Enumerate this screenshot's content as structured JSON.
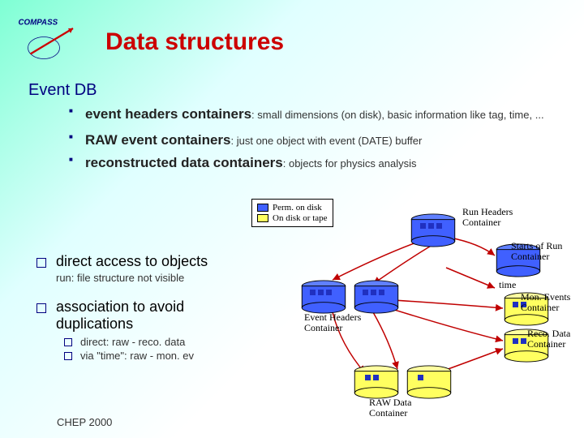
{
  "logo_text": "COMPASS",
  "title": "Data structures",
  "section_heading": "Event DB",
  "bullets": [
    {
      "strong": "event headers containers",
      "rest": ": small dimensions (on disk), basic information like tag, time, ..."
    },
    {
      "strong": "RAW event containers",
      "rest": ": just one object with event (DATE) buffer"
    },
    {
      "strong": "reconstructed data containers",
      "rest": ": objects for physics analysis"
    }
  ],
  "q_items": [
    {
      "title": "direct access to objects",
      "sub": "run: file structure not visible"
    },
    {
      "title": "association to avoid duplications",
      "bullets": [
        "direct: raw - reco. data",
        "via \"time\": raw - mon. ev"
      ]
    }
  ],
  "legend": {
    "perm": "Perm. on disk",
    "tape": "On disk or tape"
  },
  "diagram_labels": {
    "run_headers": "Run Headers\nContainer",
    "starts_run": "Starts of Run\nContainer",
    "event_headers": "Event Headers\nContainer",
    "mon_events": "Mon. Events\nContainer",
    "reco_data": "Reco. Data\nContainer",
    "raw_data": "RAW Data\nContainer",
    "time": "time"
  },
  "footer": "CHEP 2000"
}
